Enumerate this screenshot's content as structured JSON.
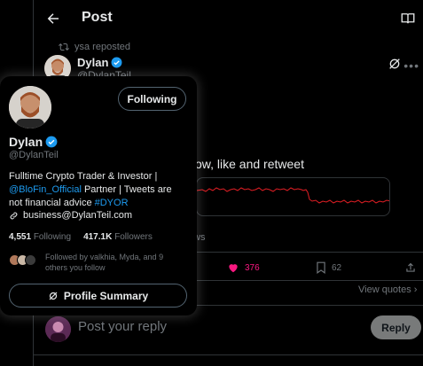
{
  "header": {
    "title": "Post"
  },
  "repost": {
    "text": "ysa reposted"
  },
  "tweet": {
    "name": "Dylan",
    "handle": "@DylanTeil",
    "text_fragment": "ow, like and retweet",
    "views_fragment": "ws"
  },
  "actions": {
    "likes": "376",
    "bookmarks": "62"
  },
  "view_quotes": "View quotes",
  "reply": {
    "placeholder": "Post your reply",
    "button_label": "Reply"
  },
  "hover_card": {
    "following_label": "Following",
    "name": "Dylan",
    "handle": "@DylanTeil",
    "bio_line1": "Fulltime Crypto Trader & Investor |",
    "bio_mention": "@BloFin_Official",
    "bio_line2_rest": " Partner | Tweets are",
    "bio_line3_start": "not financial advice ",
    "bio_hashtag": "#DYOR",
    "email": "business@DylanTeil.com",
    "following_count": "4,551",
    "following_label_text": "Following",
    "followers_count": "417.1K",
    "followers_label_text": "Followers",
    "followed_by": "Followed by valkhia, Myda, and 9 others you follow",
    "profile_summary_label": "Profile Summary"
  },
  "colors": {
    "background": "#000000",
    "accent_blue": "#1d9bf0",
    "like_pink": "#f91880",
    "muted": "#71767b",
    "chart_red": "#e01e24"
  }
}
